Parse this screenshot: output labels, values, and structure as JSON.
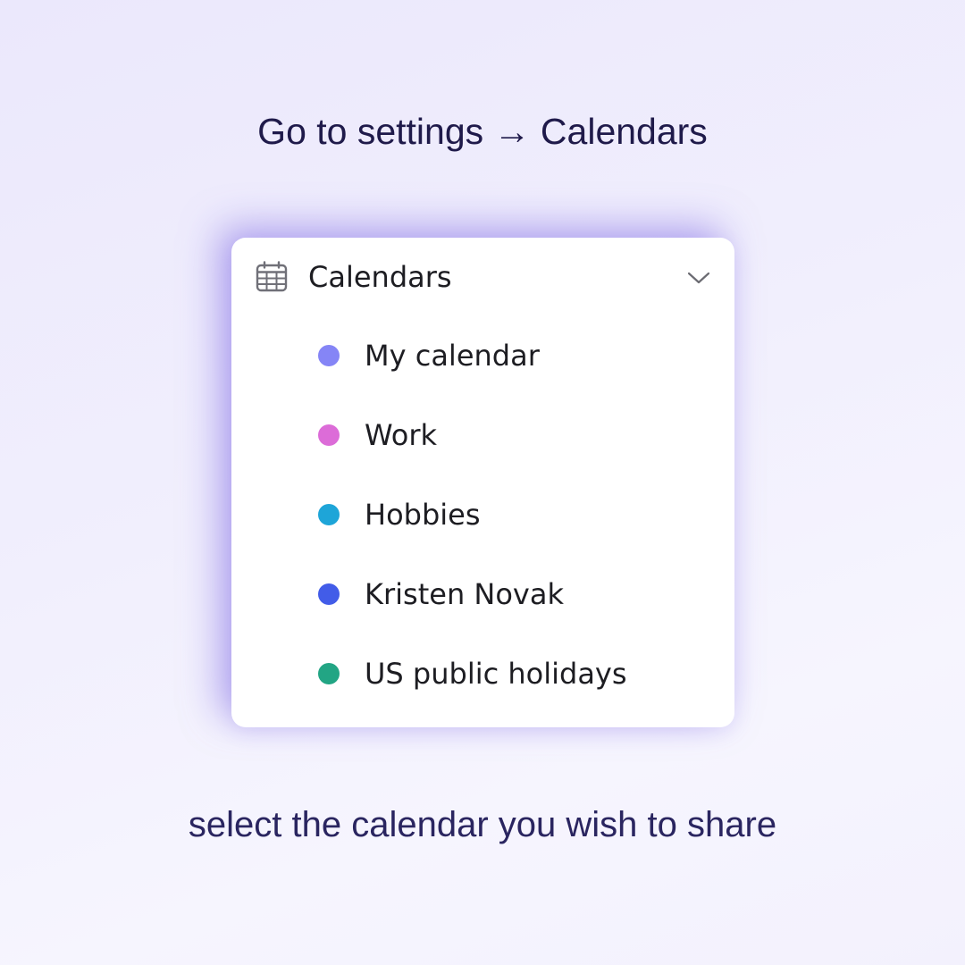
{
  "headline": "Go to settings → Calendars",
  "card": {
    "header_label": "Calendars",
    "header_icon": "calendar-grid-icon",
    "toggle_icon": "chevron-down-icon",
    "expanded": true,
    "items": [
      {
        "label": "My calendar",
        "color": "#8585f6"
      },
      {
        "label": "Work",
        "color": "#dc6cd8"
      },
      {
        "label": "Hobbies",
        "color": "#1ea5d8"
      },
      {
        "label": "Kristen Novak",
        "color": "#425ce8"
      },
      {
        "label": "US public holidays",
        "color": "#22a584"
      }
    ]
  },
  "caption": "select the calendar you wish to share"
}
